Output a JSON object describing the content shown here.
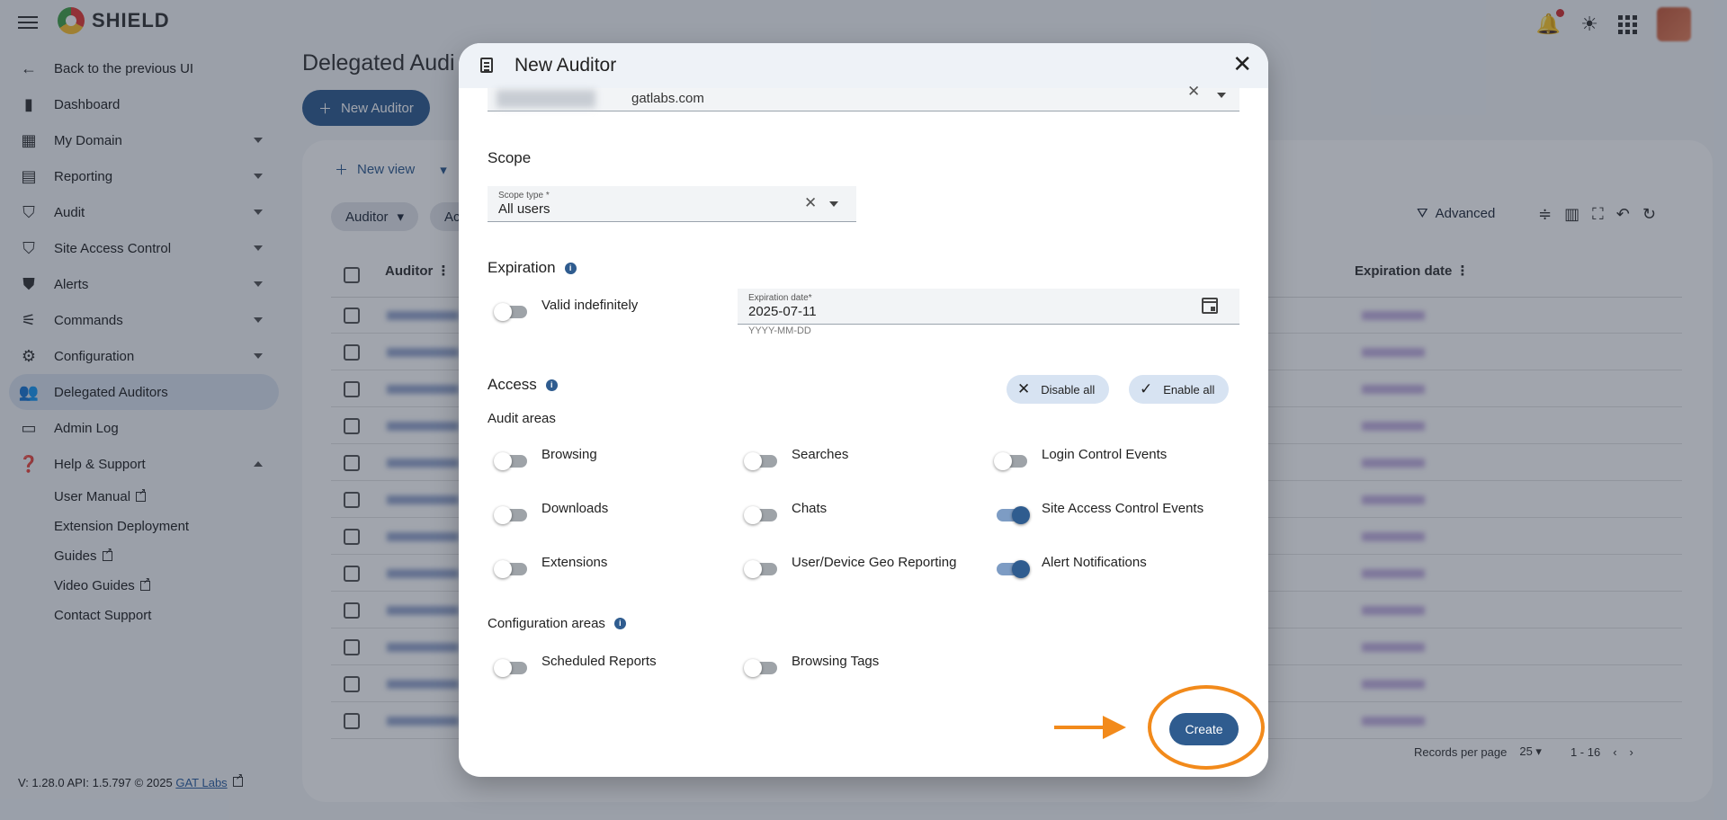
{
  "app": {
    "brand": "SHIELD"
  },
  "sidebar": {
    "back": "Back to the previous UI",
    "items": [
      {
        "label": "Dashboard",
        "icon": "bar-chart-icon",
        "caret": false
      },
      {
        "label": "My Domain",
        "icon": "domain-icon",
        "caret": true
      },
      {
        "label": "Reporting",
        "icon": "clipboard-icon",
        "caret": true
      },
      {
        "label": "Audit",
        "icon": "audit-shield-icon",
        "caret": true
      },
      {
        "label": "Site Access Control",
        "icon": "site-access-icon",
        "caret": true
      },
      {
        "label": "Alerts",
        "icon": "alert-shield-icon",
        "caret": true
      },
      {
        "label": "Commands",
        "icon": "commands-icon",
        "caret": true
      },
      {
        "label": "Configuration",
        "icon": "gear-icon",
        "caret": true
      },
      {
        "label": "Delegated Auditors",
        "icon": "people-icon",
        "caret": false,
        "active": true
      },
      {
        "label": "Admin Log",
        "icon": "log-icon",
        "caret": false
      },
      {
        "label": "Help & Support",
        "icon": "help-icon",
        "caret": true,
        "expanded": true
      }
    ],
    "help_subitems": [
      {
        "label": "User Manual",
        "external": true
      },
      {
        "label": "Extension Deployment",
        "external": false
      },
      {
        "label": "Guides",
        "external": true
      },
      {
        "label": "Video Guides",
        "external": true
      },
      {
        "label": "Contact Support",
        "external": false
      }
    ],
    "version": "V: 1.28.0   API: 1.5.797   © 2025",
    "version_link": "GAT Labs"
  },
  "page": {
    "title": "Delegated Audi",
    "new_auditor_button": "New Auditor",
    "new_view": "New view",
    "chips": [
      "Auditor",
      "Ac"
    ],
    "advanced": "Advanced",
    "columns": {
      "auditor": "Auditor",
      "expiration": "Expiration date"
    },
    "row_count": 12,
    "pager": {
      "label": "Records per page",
      "per_page": "25",
      "range": "1 - 16"
    }
  },
  "modal": {
    "title": "New Auditor",
    "domain_value": "gatlabs.com",
    "scope": {
      "title": "Scope",
      "field_label": "Scope type *",
      "value": "All users"
    },
    "expiration": {
      "title": "Expiration",
      "valid_indefinitely": "Valid indefinitely",
      "valid_indefinitely_on": false,
      "date_label": "Expiration date*",
      "date_value": "2025-07-11",
      "date_hint": "YYYY-MM-DD"
    },
    "access": {
      "title": "Access",
      "disable_all": "Disable all",
      "enable_all": "Enable all",
      "audit_areas_title": "Audit areas",
      "audit_areas": [
        {
          "label": "Browsing",
          "on": false
        },
        {
          "label": "Searches",
          "on": false
        },
        {
          "label": "Login Control Events",
          "on": false
        },
        {
          "label": "Downloads",
          "on": false
        },
        {
          "label": "Chats",
          "on": false
        },
        {
          "label": "Site Access Control Events",
          "on": true
        },
        {
          "label": "Extensions",
          "on": false
        },
        {
          "label": "User/Device Geo Reporting",
          "on": false
        },
        {
          "label": "Alert Notifications",
          "on": true
        }
      ],
      "config_areas_title": "Configuration areas",
      "config_areas": [
        {
          "label": "Scheduled Reports",
          "on": false
        },
        {
          "label": "Browsing Tags",
          "on": false
        }
      ]
    },
    "create_button": "Create"
  },
  "colors": {
    "primary": "#2f5c8f",
    "highlight": "#f28a1b",
    "overlay": "rgba(30,40,60,0.42)"
  }
}
